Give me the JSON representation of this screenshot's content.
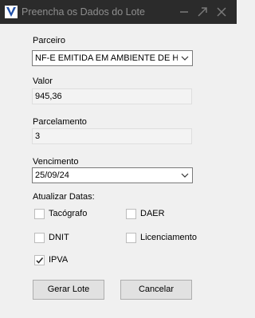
{
  "window": {
    "title": "Preencha os Dados do Lote",
    "app_icon": "app-logo-icon"
  },
  "form": {
    "parceiro": {
      "label": "Parceiro",
      "value": "NF-E EMITIDA EM AMBIENTE DE HOMOLOGACAO - SEM VALOR FISCAL"
    },
    "valor": {
      "label": "Valor",
      "value": "945,36"
    },
    "parcelamento": {
      "label": "Parcelamento",
      "value": "3"
    },
    "vencimento": {
      "label": "Vencimento",
      "value": "25/09/24"
    },
    "atualizar": {
      "label": "Atualizar Datas:",
      "options": [
        {
          "label": "Tacógrafo",
          "checked": false
        },
        {
          "label": "DAER",
          "checked": false
        },
        {
          "label": "DNIT",
          "checked": false
        },
        {
          "label": "Licenciamento",
          "checked": false
        },
        {
          "label": "IPVA",
          "checked": true
        }
      ]
    }
  },
  "buttons": {
    "gerar_label": "Gerar Lote",
    "cancelar_label": "Cancelar"
  }
}
